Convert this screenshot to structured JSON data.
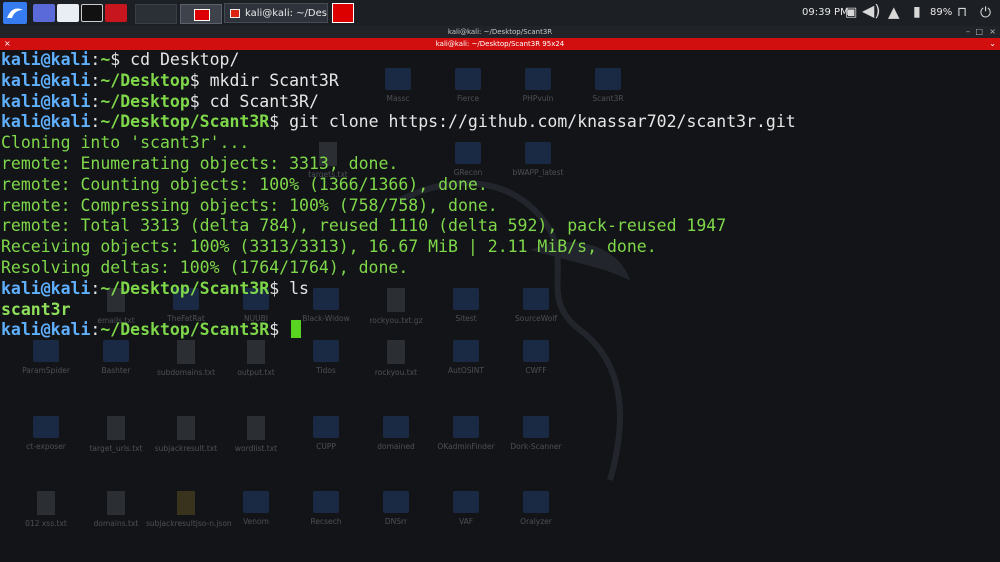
{
  "panel": {
    "clock": "09:39 PM",
    "battery_pct": "89%",
    "task_title": "kali@kali: ~/Desktop/Sc",
    "icons": [
      "kali-menu-icon",
      "desktop-icon",
      "files-icon",
      "terminal-icon",
      "recorder-icon",
      "network-icon",
      "volume-icon",
      "notification-icon",
      "battery-icon",
      "lock-icon",
      "power-icon"
    ]
  },
  "window": {
    "title": "kali@kali: ~/Desktop/Scant3R",
    "tab_title": "kali@kali: ~/Desktop/Scant3R 95x24"
  },
  "terminal": {
    "lines": [
      {
        "type": "prompt",
        "user": "kali@kali",
        "cwd": "~",
        "cmd": "cd Desktop/"
      },
      {
        "type": "prompt",
        "user": "kali@kali",
        "cwd": "~/Desktop",
        "cmd": "mkdir Scant3R"
      },
      {
        "type": "prompt",
        "user": "kali@kali",
        "cwd": "~/Desktop",
        "cmd": "cd Scant3R/"
      },
      {
        "type": "prompt",
        "user": "kali@kali",
        "cwd": "~/Desktop/Scant3R",
        "cmd": "git clone https://github.com/knassar702/scant3r.git"
      },
      {
        "type": "out",
        "text": "Cloning into 'scant3r'..."
      },
      {
        "type": "out",
        "text": "remote: Enumerating objects: 3313, done."
      },
      {
        "type": "out",
        "text": "remote: Counting objects: 100% (1366/1366), done."
      },
      {
        "type": "out",
        "text": "remote: Compressing objects: 100% (758/758), done."
      },
      {
        "type": "out",
        "text": "remote: Total 3313 (delta 784), reused 1110 (delta 592), pack-reused 1947"
      },
      {
        "type": "out",
        "text": "Receiving objects: 100% (3313/3313), 16.67 MiB | 2.11 MiB/s, done."
      },
      {
        "type": "out",
        "text": "Resolving deltas: 100% (1764/1764), done."
      },
      {
        "type": "prompt",
        "user": "kali@kali",
        "cwd": "~/Desktop/Scant3R",
        "cmd": "ls"
      },
      {
        "type": "outb",
        "text": "scant3r"
      },
      {
        "type": "prompt",
        "user": "kali@kali",
        "cwd": "~/Desktop/Scant3R",
        "cmd": "",
        "cursor": true
      }
    ]
  },
  "desktop": {
    "icons": [
      {
        "label": "Massc",
        "kind": "folder"
      },
      {
        "label": "Fierce",
        "kind": "folder"
      },
      {
        "label": "PHPvuln",
        "kind": "folder"
      },
      {
        "label": "Scant3R",
        "kind": "folder"
      },
      {
        "label": "GRecon",
        "kind": "folder"
      },
      {
        "label": "bWAPP_latest",
        "kind": "folder"
      },
      {
        "label": "targets.txt",
        "kind": "file"
      },
      {
        "label": "emails.txt",
        "kind": "file"
      },
      {
        "label": "TheFatRat",
        "kind": "folder"
      },
      {
        "label": "NUUBI",
        "kind": "folder"
      },
      {
        "label": "Black-Widow",
        "kind": "folder"
      },
      {
        "label": "rockyou.txt.gz",
        "kind": "file"
      },
      {
        "label": "Sitest",
        "kind": "folder"
      },
      {
        "label": "SourceWolf",
        "kind": "folder"
      },
      {
        "label": "ParamSpider",
        "kind": "folder"
      },
      {
        "label": "Bashter",
        "kind": "folder"
      },
      {
        "label": "subdomains.txt",
        "kind": "file"
      },
      {
        "label": "output.txt",
        "kind": "file"
      },
      {
        "label": "Tidos",
        "kind": "folder"
      },
      {
        "label": "rockyou.txt",
        "kind": "file"
      },
      {
        "label": "AutOSINT",
        "kind": "folder"
      },
      {
        "label": "CWFF",
        "kind": "folder"
      },
      {
        "label": "ct-exposer",
        "kind": "folder"
      },
      {
        "label": "target_urls.txt",
        "kind": "file"
      },
      {
        "label": "subjackresult.txt",
        "kind": "file"
      },
      {
        "label": "wordlist.txt",
        "kind": "file"
      },
      {
        "label": "CUPP",
        "kind": "folder"
      },
      {
        "label": "domained",
        "kind": "folder"
      },
      {
        "label": "OKadminFinder",
        "kind": "folder"
      },
      {
        "label": "Dork-Scanner",
        "kind": "folder"
      },
      {
        "label": "012 xss.txt",
        "kind": "file"
      },
      {
        "label": "domains.txt",
        "kind": "file"
      },
      {
        "label": "subjackresultjso-n.json",
        "kind": "img"
      },
      {
        "label": "Venom",
        "kind": "folder"
      },
      {
        "label": "Recsech",
        "kind": "folder"
      },
      {
        "label": "DNSrr",
        "kind": "folder"
      },
      {
        "label": "VAF",
        "kind": "folder"
      },
      {
        "label": "Oralyzer",
        "kind": "folder"
      }
    ]
  }
}
